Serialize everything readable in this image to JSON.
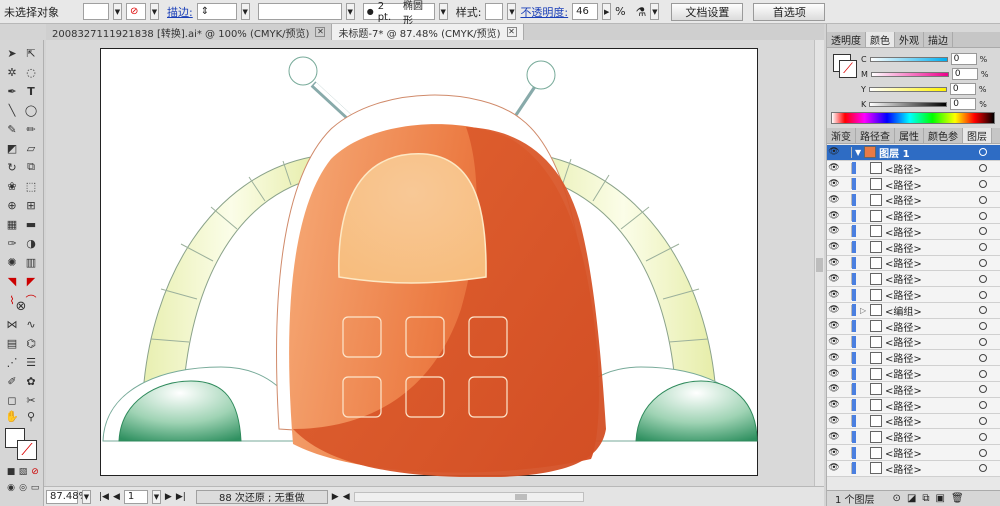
{
  "control_bar": {
    "selection_status": "未选择对象",
    "stroke_label": "描边:",
    "stroke_size": "2 pt.",
    "brush_shape": "椭圆形",
    "style_label": "样式:",
    "opacity_label": "不透明度:",
    "opacity_value": "46",
    "opacity_unit": "%",
    "doc_setup_button": "文档设置",
    "preferences_button": "首选项"
  },
  "tabs": [
    {
      "label": "2008327111921838 [转换].ai* @ 100% (CMYK/预览)",
      "active": false
    },
    {
      "label": "未标题-7* @ 87.48% (CMYK/预览)",
      "active": true
    }
  ],
  "status_bar": {
    "zoom": "87.48%",
    "page": "1",
    "history": "88 次还原 ; 无重做"
  },
  "color_panel": {
    "tabs": [
      "透明度",
      "颜色",
      "外观",
      "描边"
    ],
    "active_tab": "颜色",
    "channels": [
      {
        "label": "C",
        "value": "0",
        "unit": "%",
        "color": "#00aeef"
      },
      {
        "label": "M",
        "value": "0",
        "unit": "%",
        "color": "#ec008c"
      },
      {
        "label": "Y",
        "value": "0",
        "unit": "%",
        "color": "#fff200"
      },
      {
        "label": "K",
        "value": "0",
        "unit": "%",
        "color": "#000000"
      }
    ]
  },
  "layers_panel": {
    "tabs": [
      "渐变",
      "路径查",
      "属性",
      "颜色参",
      "图层"
    ],
    "active_tab": "图层",
    "layer_name": "图层 1",
    "items": [
      "<路径>",
      "<路径>",
      "<路径>",
      "<路径>",
      "<路径>",
      "<路径>",
      "<路径>",
      "<路径>",
      "<路径>",
      "<编组>",
      "<路径>",
      "<路径>",
      "<路径>",
      "<路径>",
      "<路径>",
      "<路径>",
      "<路径>",
      "<路径>",
      "<路径>",
      "<路径>"
    ],
    "footer": "1 个图层"
  },
  "colors": {
    "body_light": "#f3a070",
    "body_dark": "#d9532a",
    "screen": "#f7c48a",
    "foot_green": "#3a9a68",
    "arm_yellow": "#eef3b8"
  }
}
